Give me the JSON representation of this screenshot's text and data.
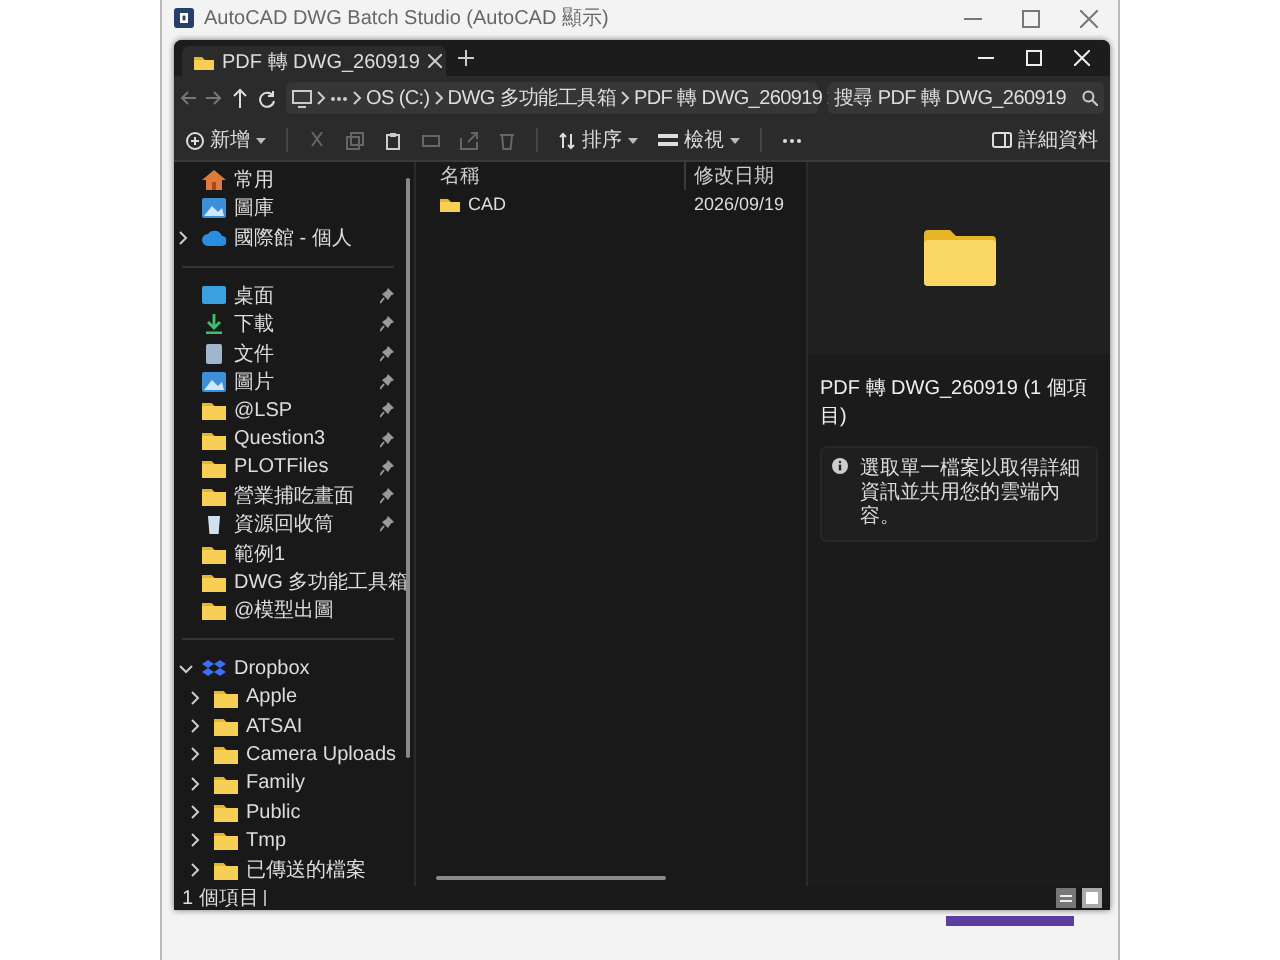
{
  "app_window": {
    "title": "AutoCAD DWG Batch Studio (AutoCAD 顯示)"
  },
  "explorer": {
    "tabs": [
      {
        "label": "PDF 轉 DWG_260919",
        "selected": true
      }
    ],
    "address": {
      "crumbs": [
        "OS (C:)",
        "DWG 多功能工具箱",
        "PDF 轉 DWG_260919"
      ],
      "search": {
        "placeholder": "搜尋 PDF 轉 DWG_260919"
      }
    },
    "toolbar": {
      "new": "新增",
      "sort": "排序",
      "view": "檢視",
      "details": "詳細資料"
    },
    "sidebar": {
      "sections": [
        {
          "items": [
            {
              "label": "常用",
              "kind": "home"
            },
            {
              "label": "圖庫",
              "kind": "gallery"
            },
            {
              "label": "國際館 - 個人",
              "kind": "cloud",
              "expanded": false
            }
          ]
        },
        {
          "items": [
            {
              "label": "桌面",
              "kind": "desktop",
              "pinned": true
            },
            {
              "label": "下載",
              "kind": "download",
              "pinned": true
            },
            {
              "label": "文件",
              "kind": "document",
              "pinned": true
            },
            {
              "label": "圖片",
              "kind": "picture",
              "pinned": true
            },
            {
              "label": "@LSP",
              "kind": "folder",
              "pinned": true
            },
            {
              "label": "Question3",
              "kind": "folder",
              "pinned": true
            },
            {
              "label": "PLOTFiles",
              "kind": "folder",
              "pinned": true
            },
            {
              "label": "營業捕吃畫面",
              "kind": "folder",
              "pinned": true
            },
            {
              "label": "資源回收筒",
              "kind": "recycle",
              "pinned": true
            },
            {
              "label": "範例1",
              "kind": "folder",
              "pinned": false
            },
            {
              "label": "DWG 多功能工具箱",
              "kind": "folder",
              "pinned": false
            },
            {
              "label": "@模型出圖",
              "kind": "folder",
              "pinned": false
            }
          ]
        },
        {
          "items": [
            {
              "label": "Dropbox",
              "kind": "dropbox",
              "expanded": true,
              "children": [
                {
                  "label": "Apple",
                  "kind": "folder",
                  "expanded": false
                },
                {
                  "label": "ATSAI",
                  "kind": "folder",
                  "expanded": false
                },
                {
                  "label": "Camera Uploads",
                  "kind": "folder",
                  "expanded": false
                },
                {
                  "label": "Family",
                  "kind": "folder",
                  "expanded": false
                },
                {
                  "label": "Public",
                  "kind": "folder",
                  "expanded": false
                },
                {
                  "label": "Tmp",
                  "kind": "folder",
                  "expanded": false
                },
                {
                  "label": "已傳送的檔案",
                  "kind": "folder",
                  "expanded": false
                }
              ]
            }
          ]
        }
      ]
    },
    "file_list": {
      "columns": [
        "名稱",
        "修改日期"
      ],
      "rows": [
        {
          "name": "CAD",
          "modified": "2026/09/19",
          "selected": false
        }
      ]
    },
    "preview": {
      "title": "PDF 轉 DWG_260919 (1 個項目)",
      "info": "選取單一檔案以取得詳細資訊並共用您的雲端內容。"
    },
    "status_bar": {
      "count": "1 個項目"
    }
  }
}
